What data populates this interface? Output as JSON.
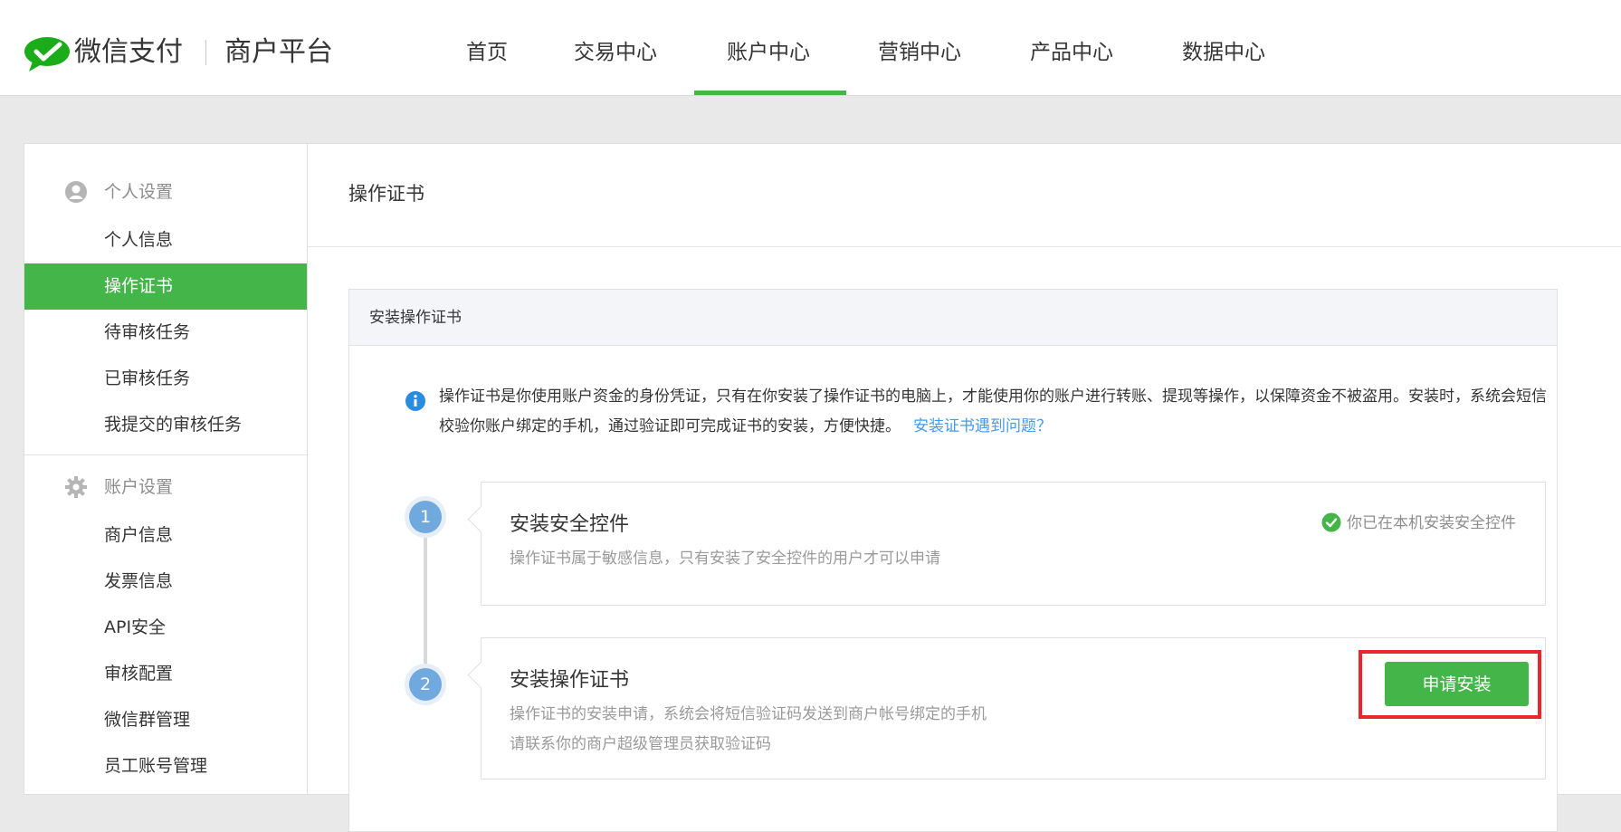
{
  "header": {
    "brand": "微信支付",
    "brand_sub": "商户平台",
    "nav": [
      "首页",
      "交易中心",
      "账户中心",
      "营销中心",
      "产品中心",
      "数据中心"
    ],
    "active_nav": "账户中心",
    "accent_color": "#44b549"
  },
  "sidebar": {
    "personal_section": "个人设置",
    "personal_items": [
      "个人信息",
      "操作证书",
      "待审核任务",
      "已审核任务",
      "我提交的审核任务"
    ],
    "active_item": "操作证书",
    "account_section": "账户设置",
    "account_items": [
      "商户信息",
      "发票信息",
      "API安全",
      "审核配置",
      "微信群管理",
      "员工账号管理"
    ]
  },
  "main": {
    "title": "操作证书",
    "card_title": "安装操作证书",
    "info_text": "操作证书是你使用账户资金的身份凭证，只有在你安装了操作证书的电脑上，才能使用你的账户进行转账、提现等操作，以保障资金不被盗用。安装时，系统会短信校验你账户绑定的手机，通过验证即可完成证书的安装，方便快捷。",
    "info_link": "安装证书遇到问题？",
    "steps": [
      {
        "num": "1",
        "title": "安装安全控件",
        "desc": "操作证书属于敏感信息，只有安装了安全控件的用户才可以申请",
        "status": "你已在本机安装安全控件"
      },
      {
        "num": "2",
        "title": "安装操作证书",
        "desc1": "操作证书的安装申请，系统会将短信验证码发送到商户帐号绑定的手机",
        "desc2": "请联系你的商户超级管理员获取验证码",
        "button": "申请安装"
      }
    ]
  }
}
